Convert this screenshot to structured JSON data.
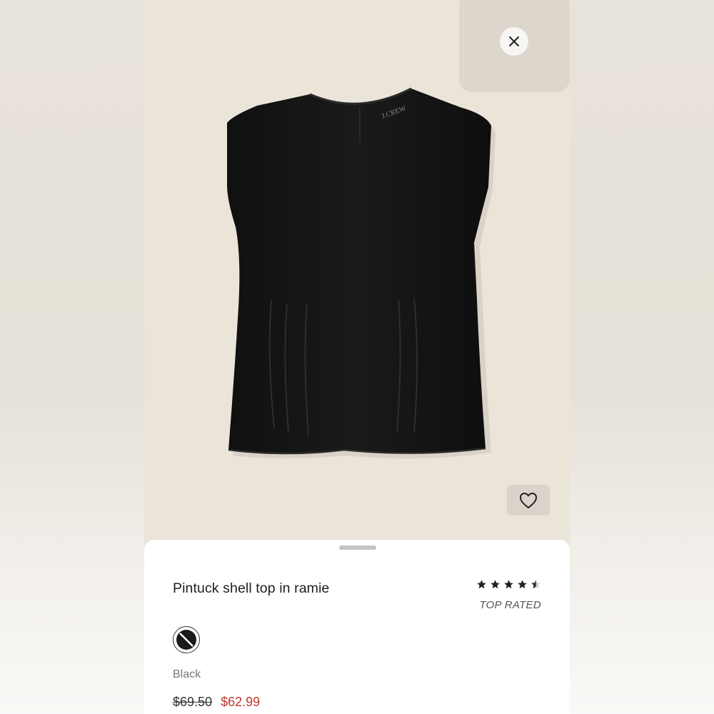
{
  "product": {
    "title": "Pintuck shell top in ramie",
    "rating": 4.5,
    "rating_max": 5,
    "rating_badge": "TOP RATED",
    "color_name": "Black",
    "price_original": "$69.50",
    "price_sale": "$62.99",
    "image_brand_label": "J.CREW"
  },
  "icons": {
    "close": "close-icon",
    "favorite": "heart-icon",
    "star": "star-icon"
  },
  "colors": {
    "sale_price": "#c0392b",
    "garment": "#141414",
    "image_background": "#ebe4d9"
  }
}
